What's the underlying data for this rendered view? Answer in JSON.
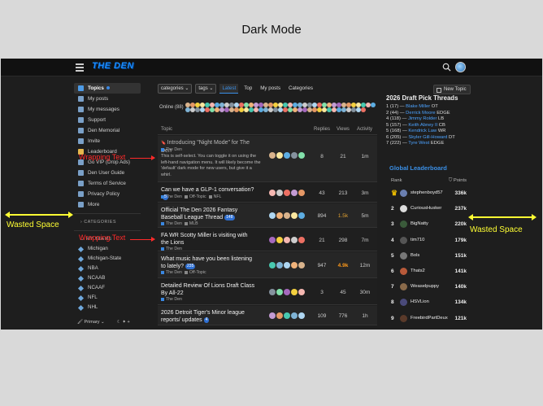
{
  "heading": "Dark Mode",
  "app": {
    "logo": "THE DEN",
    "search_icon": "search-icon",
    "menu_icon": "hamburger-icon"
  },
  "sidebar": {
    "items": [
      {
        "label": "Topics",
        "active": true,
        "icon": "topics-icon"
      },
      {
        "label": "My posts",
        "icon": "posts-icon"
      },
      {
        "label": "My messages",
        "icon": "messages-icon"
      },
      {
        "label": "Support",
        "icon": "support-icon"
      },
      {
        "label": "Den Memorial",
        "icon": "memorial-icon"
      },
      {
        "label": "Invite",
        "icon": "invite-icon"
      },
      {
        "label": "Leaderboard",
        "icon": "leaderboard-icon"
      },
      {
        "label": "Go VIP (Drop Ads)",
        "icon": "vip-icon"
      },
      {
        "label": "Den User Guide",
        "icon": "guide-icon"
      },
      {
        "label": "Terms of Service",
        "icon": "tos-icon"
      },
      {
        "label": "Privacy Policy",
        "icon": "privacy-icon"
      },
      {
        "label": "More",
        "icon": "more-icon"
      }
    ],
    "categories_head": "CATEGORIES",
    "teams_head": "MY TEAMS",
    "teams": [
      "Michigan",
      "Michigan-State",
      "NBA",
      "NCAAB",
      "NCAAF",
      "NFL",
      "NHL"
    ],
    "footer": "Primary"
  },
  "nav": {
    "categories": "categories",
    "tags": "tags",
    "tabs": [
      "Latest",
      "Top",
      "My posts",
      "Categories"
    ],
    "new_topic": "New Topic"
  },
  "online_label": "Online (88)",
  "table_head": {
    "topic": "Topic",
    "replies": "Replies",
    "views": "Views",
    "activity": "Activity"
  },
  "topics": [
    {
      "title": "Introducing \"Night Mode\" for The Den",
      "category": "The Den",
      "excerpt": "This is self-select. You can toggle it on using the left-hand navigation menu. It will likely become the 'default' dark mode for new users, but give it a whirl.",
      "replies": "8",
      "views": "21",
      "activity": "1m"
    },
    {
      "title": "Can we have a GLP-1 conversation?",
      "badge": "5",
      "category": "The Den",
      "tag1": "Off-Topic",
      "tag2": "NFL",
      "replies": "43",
      "views": "213",
      "activity": "3m"
    },
    {
      "title": "Official The Den 2026 Fantasy Baseball League Thread",
      "badge": "148",
      "category": "The Den",
      "tag1": "MLB",
      "replies": "894",
      "views": "1.5k",
      "activity": "5m"
    },
    {
      "title": "FA WR Scotty Miller is visiting with the Lions",
      "category": "The Den",
      "replies": "21",
      "views": "298",
      "activity": "7m"
    },
    {
      "title": "What music have you been listening to lately?",
      "badge": "235",
      "category": "The Den",
      "tag1": "Off-Topic",
      "replies": "947",
      "views": "4.9k",
      "activity": "12m"
    },
    {
      "title": "Detailed Review Of Lions Draft Class By All-22",
      "category": "The Den",
      "replies": "3",
      "views": "45",
      "activity": "30m"
    },
    {
      "title": "2026 Detroit Tiger's Minor league reports/ updates",
      "badge": "4",
      "replies": "109",
      "views": "776",
      "activity": "1h"
    }
  ],
  "draft": {
    "title": "2026 Draft Pick Threads",
    "picks": [
      {
        "pre": "1 (17) — ",
        "name": "Blake Miller",
        "pos": " OT"
      },
      {
        "pre": "2 (44) — ",
        "name": "Derrick Moore",
        "pos": " EDGE"
      },
      {
        "pre": "4 (118) — ",
        "name": "Jimmy Rolder",
        "pos": " LB"
      },
      {
        "pre": "5 (157) — ",
        "name": "Keith Abney II",
        "pos": " CB"
      },
      {
        "pre": "5 (168) — ",
        "name": "Kendrick Law",
        "pos": " WR"
      },
      {
        "pre": "6 (205) — ",
        "name": "Skyler Gill-Howard",
        "pos": " DT"
      },
      {
        "pre": "7 (222) — ",
        "name": "Tyre West",
        "pos": " EDGE"
      }
    ]
  },
  "leaderboard": {
    "title": "Global Leaderboard",
    "rank_label": "Rank",
    "points_label": "Points",
    "rows": [
      {
        "rank": "1",
        "name": "stephenboyd57",
        "points": "336k",
        "color": "#6a7fb0"
      },
      {
        "rank": "2",
        "name": "CuriousHusker",
        "points": "237k",
        "color": "#dddddd"
      },
      {
        "rank": "3",
        "name": "BigNatty",
        "points": "220k",
        "color": "#3a5a3a"
      },
      {
        "rank": "4",
        "name": "tim710",
        "points": "179k",
        "color": "#555555"
      },
      {
        "rank": "5",
        "name": "Bols",
        "points": "151k",
        "color": "#777777"
      },
      {
        "rank": "6",
        "name": "Thats2",
        "points": "141k",
        "color": "#b85a3a"
      },
      {
        "rank": "7",
        "name": "Weaselpuppy",
        "points": "140k",
        "color": "#8a6a4a"
      },
      {
        "rank": "8",
        "name": "HSVLion",
        "points": "134k",
        "color": "#4a4a7a"
      },
      {
        "rank": "9",
        "name": "FreebirdPartDeux",
        "points": "121k",
        "color": "#5a3a2a"
      }
    ]
  },
  "annotations": {
    "wasted_left": "Wasted Space",
    "wasted_right": "Wasted Space",
    "wrap1": "Wrapping Text",
    "wrap2": "Wrapping Text"
  }
}
